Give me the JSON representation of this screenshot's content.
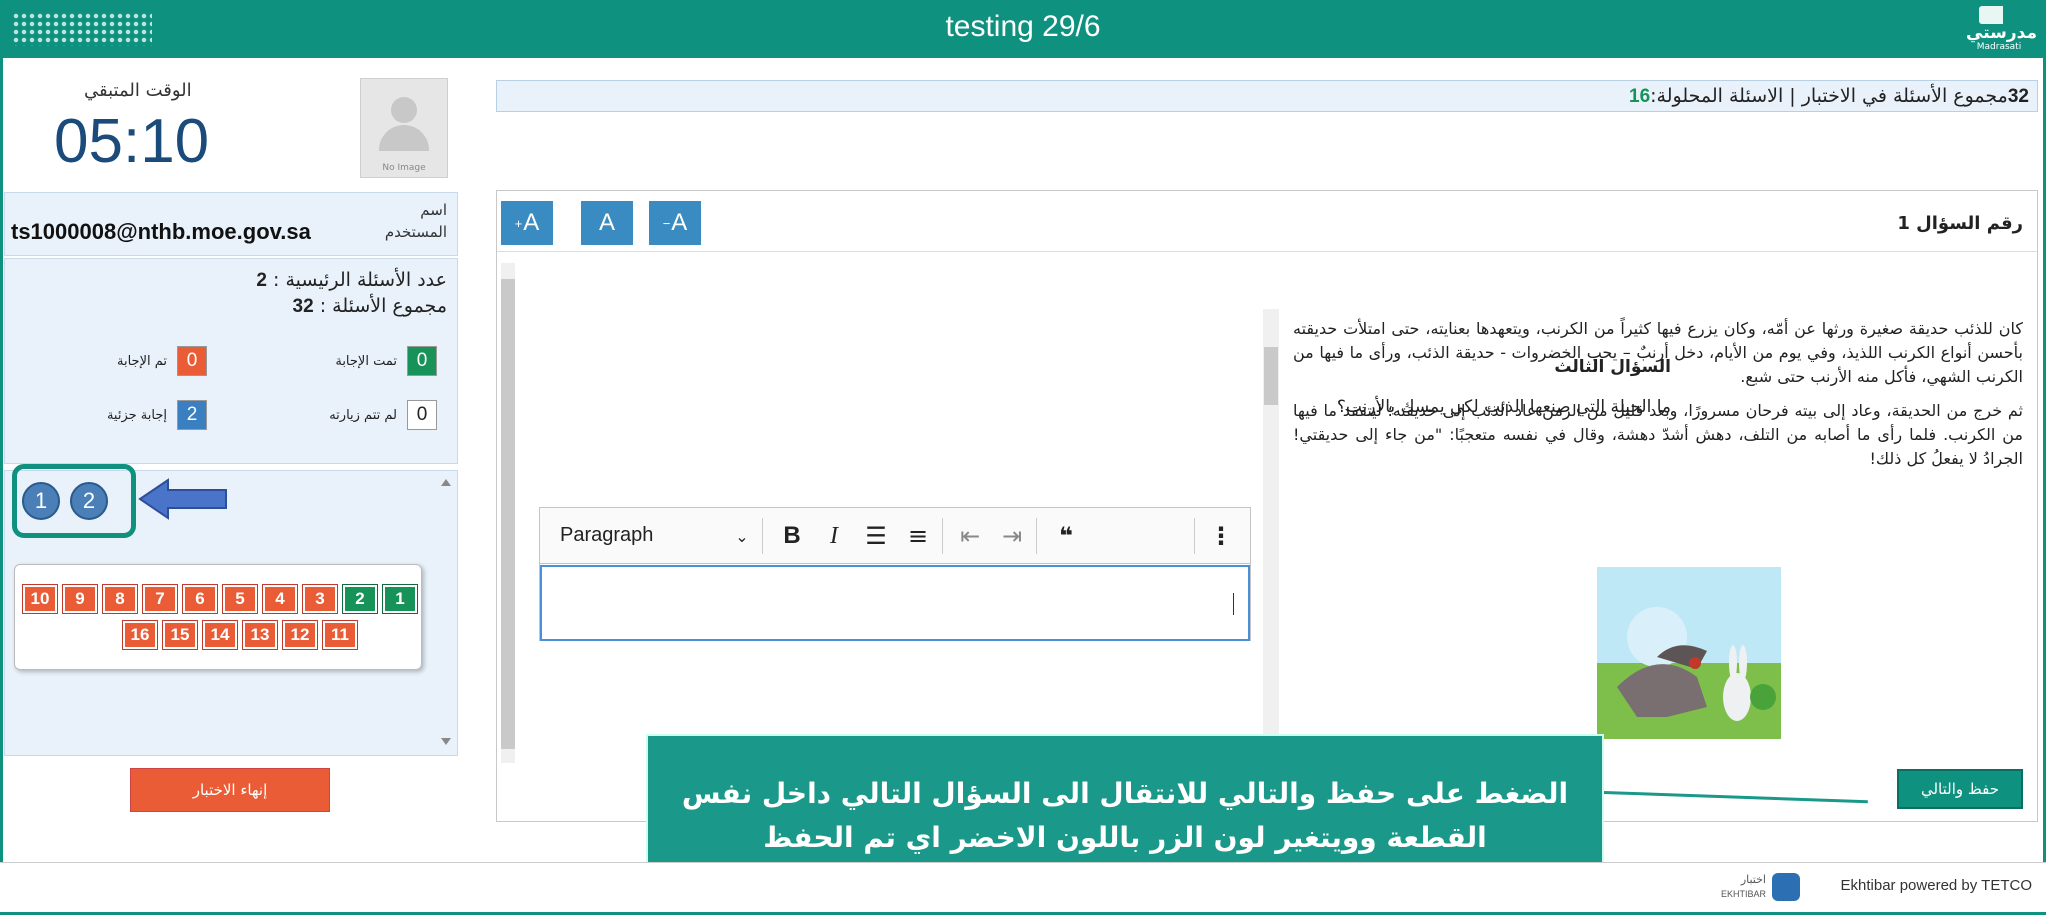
{
  "app": {
    "title": "testing 29/6",
    "logo_ar": "مدرستي",
    "logo_en": "Madrasati"
  },
  "timer": {
    "label": "الوقت المتبقي",
    "value": "05:10"
  },
  "avatar": {
    "label": "No Image"
  },
  "user": {
    "label_line1": "اسم",
    "label_line2": "المستخدم",
    "email": "ts1000008@nthb.moe.gov.sa"
  },
  "stats": {
    "main_questions_label": "عدد الأسئلة الرئيسية :",
    "main_questions_value": "2",
    "total_questions_label": "مجموع الأسئلة :",
    "total_questions_value": "32",
    "legend": [
      {
        "label": "تمت الإجابة",
        "value": "0",
        "color": "#179258"
      },
      {
        "label": "تم الإجابة",
        "value": "0",
        "color": "#e95c35"
      },
      {
        "label": "لم تتم زيارته",
        "value": "0",
        "color": "#ffffff"
      },
      {
        "label": "إجابة جزئية",
        "value": "2",
        "color": "#3a7fc0"
      }
    ]
  },
  "nav": {
    "main_buttons": [
      "1",
      "2"
    ],
    "questions_row1": [
      "10",
      "9",
      "8",
      "7",
      "6",
      "5",
      "4",
      "3",
      "2",
      "1"
    ],
    "questions_row2": [
      "16",
      "15",
      "14",
      "13",
      "12",
      "11"
    ]
  },
  "end_button": "إنهاء الاختبار",
  "summary": {
    "total": "32",
    "total_text": "مجموع الأسئلة في الاختبار | الاسئلة المحلولة:",
    "solved": "16"
  },
  "font_controls": {
    "increase": "A",
    "normal": "A",
    "decrease": "A"
  },
  "question": {
    "number_label": "رقم السؤال 1",
    "sub_title": "السؤال الثالث",
    "sub_text": "ما الحيلة التي صنعها الذئب لكي يمسك بالأرنب؟"
  },
  "editor": {
    "block_format": "Paragraph"
  },
  "passage": {
    "p1": "كان للذئب حديقة صغيرة ورثها عن أمّه، وكان يزرع فيها كثيراً من الكرنب، ويتعهدها بعنايته، حتى امتلأت حديقته بأحسن أنواع الكرنب اللذيذ، وفي يوم من الأيام، دخل أرنبٌ – يحب الخضروات - حديقة الذئب، ورأى ما فيها من الكرنب الشهي، فأكل منه الأرنب حتى شبع.",
    "p2": "ثم خرج من الحديقة، وعاد إلى بيته فرحان مسرورًا، وبعد قليل من الزمن عاد الذئب إلى حديقته؛ ليتفقد ما فيها من الكرنب. فلما رأى ما أصابه من التلف، دهش أشدّ دهشة، وقال في نفسه متعجبًا: \"من جاء إلى حديقتي! الجرادُ لا يفعلُ كل ذلك!"
  },
  "save_next": "حفظ والتالي",
  "callout": {
    "line1": "الضغط على حفظ والتالي للانتقال الى السؤال التالي داخل نفس",
    "line2": "القطعة وويتغير لون الزر باللون الاخضر اي تم الحفظ"
  },
  "footer": {
    "powered_by": "Ekhtibar powered by TETCO",
    "logo_ar": "اختبار",
    "logo_en": "EKHTIBAR"
  },
  "colors": {
    "brand": "#0f9180",
    "accent_blue": "#3a8bc2",
    "red": "#e95c35",
    "green": "#179258"
  }
}
